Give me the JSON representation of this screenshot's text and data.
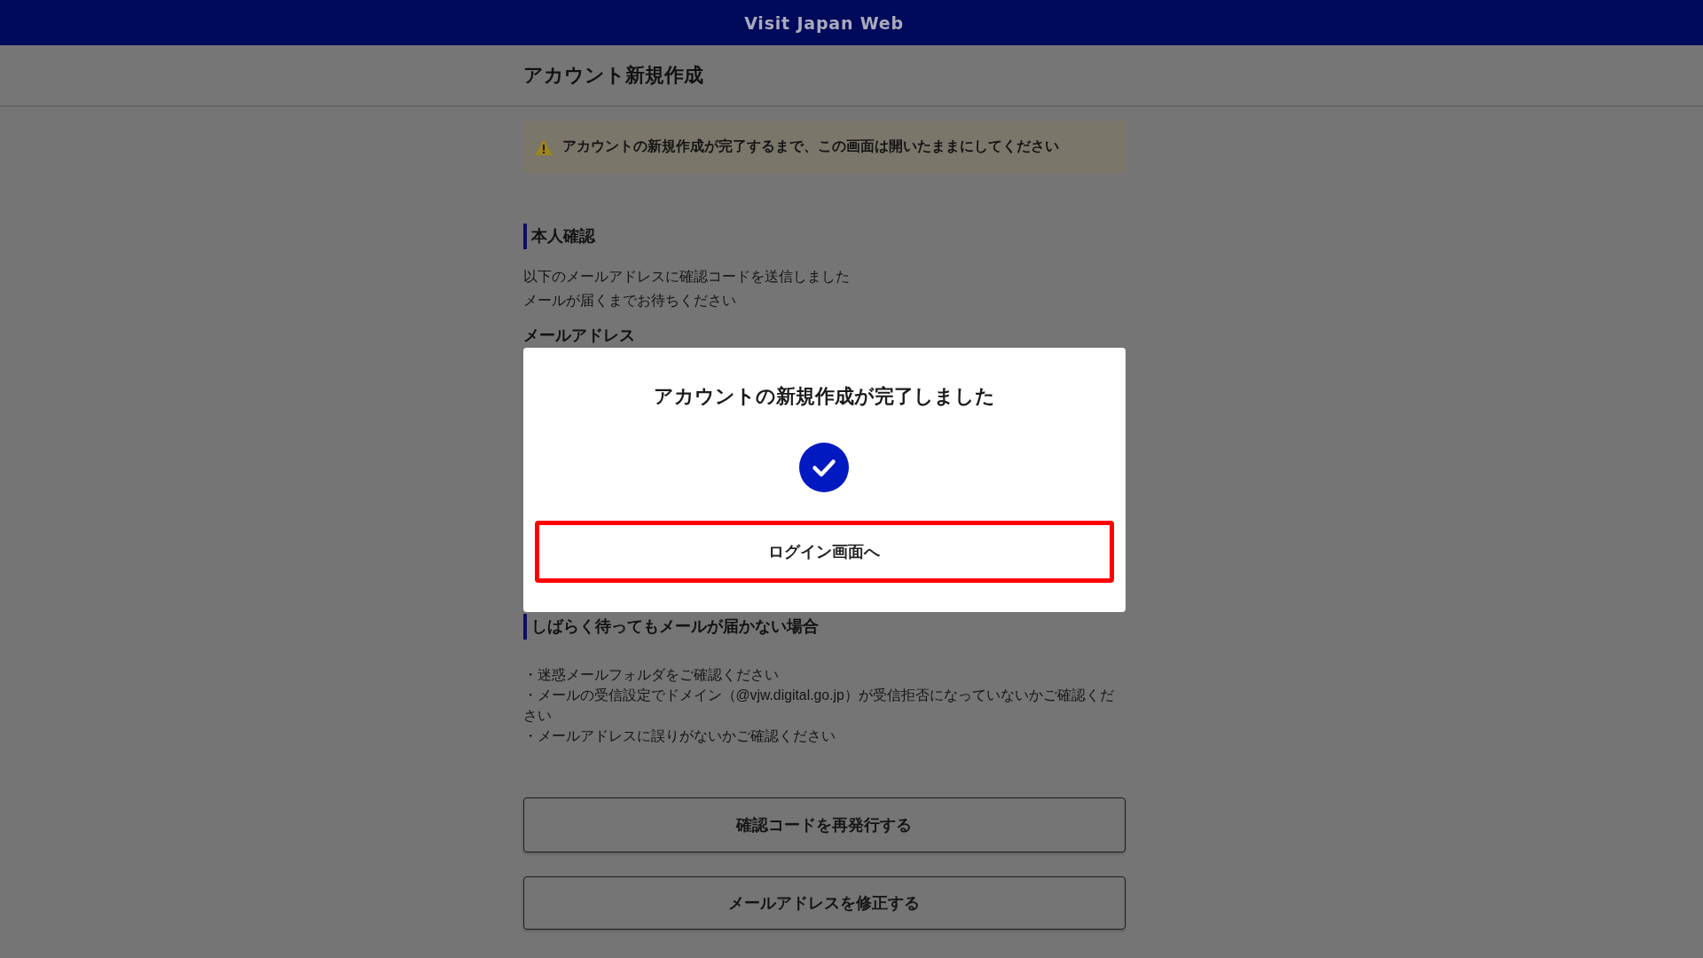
{
  "header": {
    "title": "Visit Japan Web"
  },
  "page_title": "アカウント新規作成",
  "notice": {
    "text": "アカウントの新規作成が完了するまで、この画面は開いたままにしてください"
  },
  "identity_section": {
    "heading": "本人確認",
    "lines": [
      "以下のメールアドレスに確認コードを送信しました",
      "メールが届くまでお待ちください"
    ],
    "field_label": "メールアドレス"
  },
  "no_mail_section": {
    "heading": "しばらく待ってもメールが届かない場合",
    "items": [
      "・迷惑メールフォルダをご確認ください",
      "・メールの受信設定でドメイン（@vjw.digital.go.jp）が受信拒否になっていないかご確認ください",
      "・メールアドレスに誤りがないかご確認ください"
    ]
  },
  "buttons": [
    {
      "label": "確認コードを再発行する"
    },
    {
      "label": "メールアドレスを修正する"
    }
  ],
  "dialog": {
    "title": "アカウントの新規作成が完了しました",
    "button": {
      "label": "ログイン画面へ"
    }
  }
}
